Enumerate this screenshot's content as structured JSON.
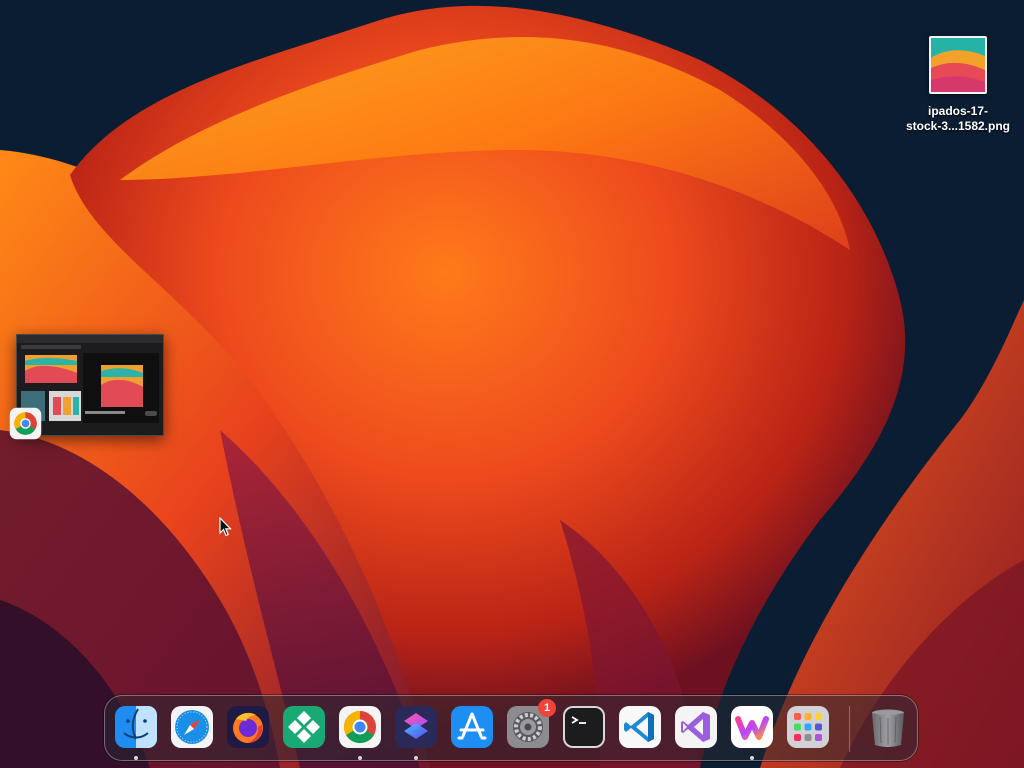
{
  "desktop": {
    "file_icon": {
      "name": "ipados-17-\nstock-3...1582.png"
    }
  },
  "minimized_window": {
    "app": "Google Chrome",
    "icon": "chrome-icon"
  },
  "dock": {
    "apps": [
      {
        "name": "Finder",
        "icon": "finder-icon",
        "running": true
      },
      {
        "name": "Safari",
        "icon": "safari-icon",
        "running": false
      },
      {
        "name": "Firefox",
        "icon": "firefox-icon",
        "running": false
      },
      {
        "name": "Xcode Tools",
        "icon": "diamond-app-icon",
        "running": false
      },
      {
        "name": "Google Chrome",
        "icon": "chrome-icon",
        "running": true
      },
      {
        "name": "Shortcuts",
        "icon": "shortcuts-icon",
        "running": true
      },
      {
        "name": "App Store",
        "icon": "app-store-icon",
        "running": false
      },
      {
        "name": "System Settings",
        "icon": "settings-gear-icon",
        "running": false,
        "badge": "1"
      },
      {
        "name": "Terminal",
        "icon": "terminal-icon",
        "running": false
      },
      {
        "name": "Visual Studio Code",
        "icon": "vscode-icon",
        "running": false
      },
      {
        "name": "Visual Studio",
        "icon": "visual-studio-icon",
        "running": false
      },
      {
        "name": "Wondershare",
        "icon": "wondershare-icon",
        "running": true
      },
      {
        "name": "Launchpad",
        "icon": "launchpad-icon",
        "running": false
      }
    ],
    "trash": {
      "name": "Trash",
      "icon": "trash-icon"
    }
  },
  "colors": {
    "wallpaper_orange": "#ff7a1a",
    "wallpaper_red": "#d8361c",
    "wallpaper_navy": "#0b1d33",
    "badge_red": "#f0443a"
  }
}
